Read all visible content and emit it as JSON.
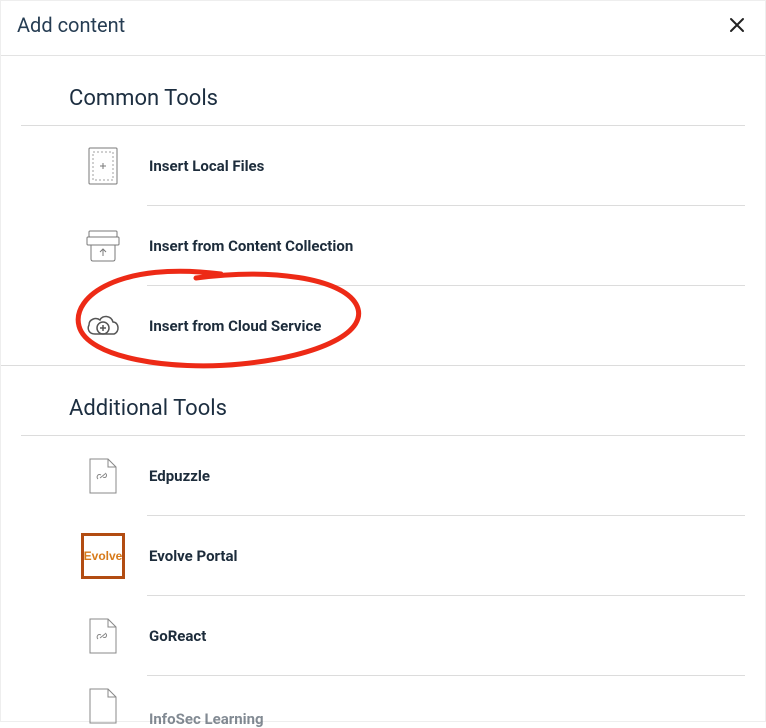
{
  "dialog": {
    "title": "Add content"
  },
  "sections": {
    "common": {
      "heading": "Common Tools",
      "items": {
        "local_files": "Insert Local Files",
        "content_collection": "Insert from Content Collection",
        "cloud_service": "Insert from Cloud Service"
      }
    },
    "additional": {
      "heading": "Additional Tools",
      "items": {
        "edpuzzle": "Edpuzzle",
        "evolve_portal": "Evolve Portal",
        "evolve_badge_text": "Evolve",
        "goreact": "GoReact",
        "infosec": "InfoSec Learning"
      }
    }
  }
}
